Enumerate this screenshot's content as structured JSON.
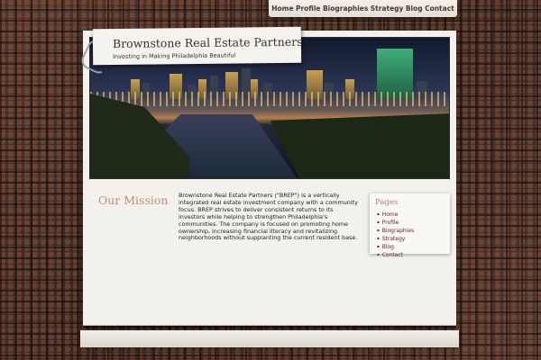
{
  "nav": {
    "items": [
      "Home",
      "Profile",
      "Biographies",
      "Strategy",
      "Blog",
      "Contact"
    ]
  },
  "header": {
    "title": "Brownstone Real Estate Partners",
    "tagline": "Investing in Making Philadelphia Beautiful"
  },
  "mission": {
    "heading": "Our Mission",
    "body": "Brownstone Real Estate Partners (\"BREP\") is a vertically integrated real estate investment company with a community focus. BREP strives to deliver consistent returns to its investors while helping to strengthen Philadelphia's communities. The company is focused on promoting home ownership, increasing financial literacy and revitalizing neighborhoods without supplanting the current resident base."
  },
  "sidebar": {
    "heading": "Pages",
    "items": [
      "Home",
      "Profile",
      "Biographies",
      "Strategy",
      "Blog",
      "Contact"
    ]
  }
}
